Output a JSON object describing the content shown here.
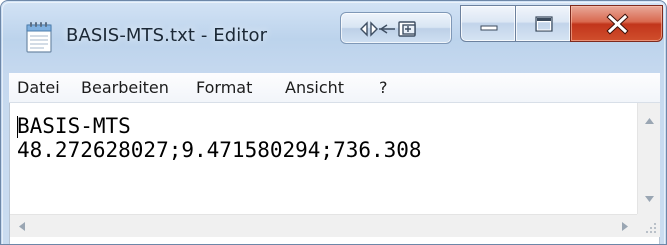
{
  "window": {
    "title": "BASIS-MTS.txt - Editor",
    "app_icon": "notepad-icon",
    "caption_buttons": [
      "minimize-icon",
      "maximize-icon",
      "close-icon"
    ],
    "extra_button_icon": "network-share-icon",
    "colors": {
      "frame": "#bcd3ec",
      "close_button": "#c2351b",
      "menubar": "#f2f5fa",
      "text": "#000000"
    }
  },
  "menubar": {
    "items": [
      "Datei",
      "Bearbeiten",
      "Format",
      "Ansicht",
      "?"
    ]
  },
  "editor": {
    "lines": [
      "BASIS-MTS",
      "48.272628027;9.471580294;736.308"
    ]
  },
  "scrollbars": {
    "vertical_arrows": [
      "scroll-up-icon",
      "scroll-down-icon"
    ],
    "horizontal_arrows": [
      "scroll-left-icon",
      "scroll-right-icon"
    ]
  }
}
